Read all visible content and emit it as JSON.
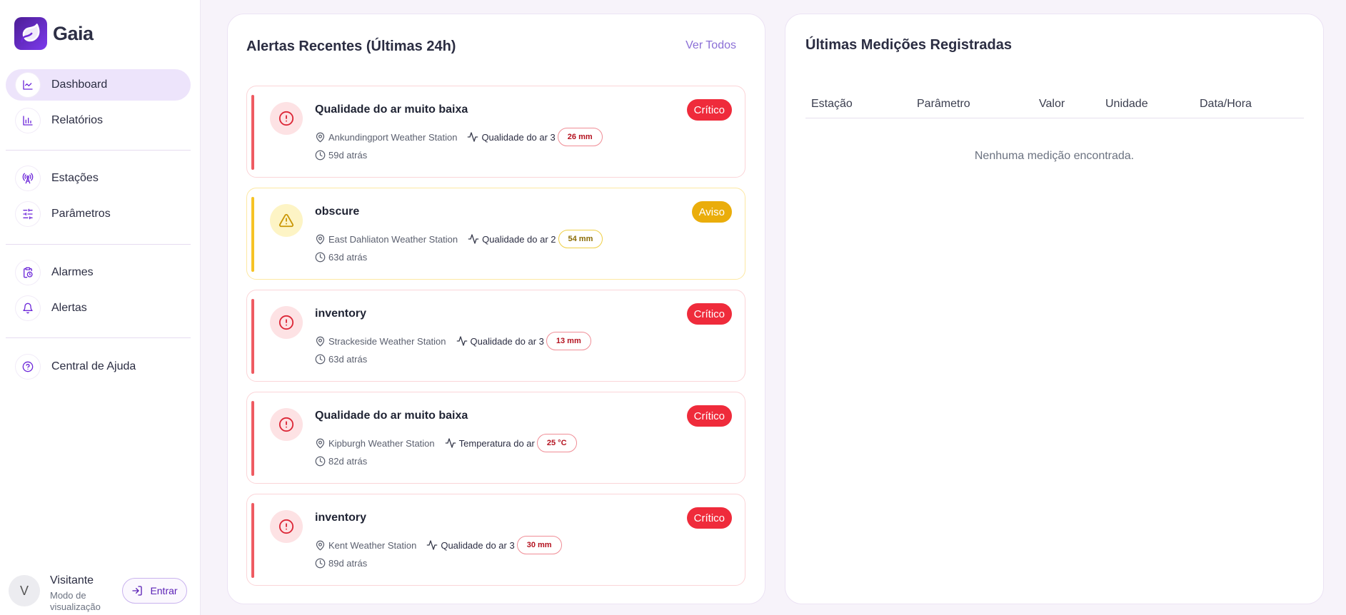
{
  "app": {
    "name": "Gaia"
  },
  "sidebar": {
    "items": [
      {
        "label": "Dashboard",
        "icon": "chart-line-icon",
        "active": true
      },
      {
        "label": "Relatórios",
        "icon": "bar-chart-icon"
      },
      {
        "label": "Estações",
        "icon": "radio-tower-icon"
      },
      {
        "label": "Parâmetros",
        "icon": "sliders-icon"
      },
      {
        "label": "Alarmes",
        "icon": "clipboard-clock-icon"
      },
      {
        "label": "Alertas",
        "icon": "bell-icon"
      },
      {
        "label": "Central de Ajuda",
        "icon": "help-circle-icon"
      }
    ]
  },
  "user": {
    "initial": "V",
    "name": "Visitante",
    "mode": "Modo de visualização",
    "login_label": "Entrar"
  },
  "alerts": {
    "title": "Alertas Recentes (Últimas 24h)",
    "see_all": "Ver Todos",
    "items": [
      {
        "title": "Qualidade do ar muito baixa",
        "level": "Crítico",
        "station": "Ankundingport Weather Station",
        "parameter": "Qualidade do ar 3",
        "value": "26 mm",
        "time": "59d atrás"
      },
      {
        "title": "obscure",
        "level": "Aviso",
        "station": "East Dahliaton Weather Station",
        "parameter": "Qualidade do ar 2",
        "value": "54 mm",
        "time": "63d atrás"
      },
      {
        "title": "inventory",
        "level": "Crítico",
        "station": "Strackeside Weather Station",
        "parameter": "Qualidade do ar 3",
        "value": "13 mm",
        "time": "63d atrás"
      },
      {
        "title": "Qualidade do ar muito baixa",
        "level": "Crítico",
        "station": "Kipburgh Weather Station",
        "parameter": "Temperatura do ar",
        "value": "25 °C",
        "time": "82d atrás"
      },
      {
        "title": "inventory",
        "level": "Crítico",
        "station": "Kent Weather Station",
        "parameter": "Qualidade do ar 3",
        "value": "30 mm",
        "time": "89d atrás"
      }
    ]
  },
  "measurements": {
    "title": "Últimas Medições Registradas",
    "columns": [
      "Estação",
      "Parâmetro",
      "Valor",
      "Unidade",
      "Data/Hora"
    ],
    "empty_message": "Nenhuma medição encontrada."
  },
  "colors": {
    "accent": "#7c3aed",
    "critical": "#ef2b3b",
    "warning": "#eaad0b",
    "background": "#f7f3fa"
  }
}
